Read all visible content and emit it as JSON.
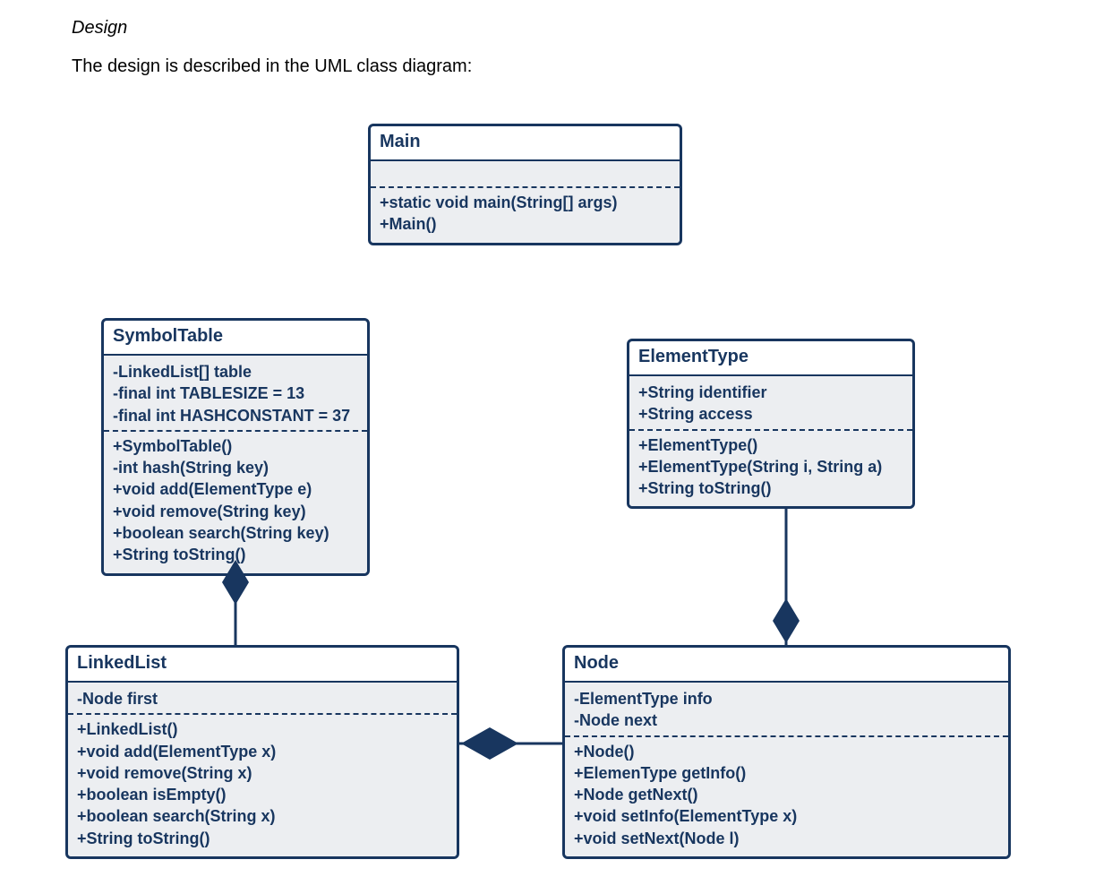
{
  "heading": "Design",
  "intro": "The design is described in the UML class diagram:",
  "classes": {
    "main": {
      "name": "Main",
      "attrs": [],
      "ops": [
        "+static void main(String[] args)",
        "+Main()"
      ]
    },
    "symbolTable": {
      "name": "SymbolTable",
      "attrs": [
        "-LinkedList[] table",
        "-final int TABLESIZE = 13",
        "-final int HASHCONSTANT = 37"
      ],
      "ops": [
        "+SymbolTable()",
        "-int hash(String key)",
        "+void add(ElementType e)",
        "+void remove(String key)",
        "+boolean search(String key)",
        "+String toString()"
      ]
    },
    "elementType": {
      "name": "ElementType",
      "attrs": [
        "+String identifier",
        "+String access"
      ],
      "ops": [
        "+ElementType()",
        "+ElementType(String i, String a)",
        "+String toString()"
      ]
    },
    "linkedList": {
      "name": "LinkedList",
      "attrs": [
        "-Node first"
      ],
      "ops": [
        "+LinkedList()",
        "+void add(ElementType x)",
        "+void remove(String x)",
        "+boolean isEmpty()",
        "+boolean search(String x)",
        "+String toString()"
      ]
    },
    "node": {
      "name": "Node",
      "attrs": [
        "-ElementType info",
        "-Node next"
      ],
      "ops": [
        "+Node()",
        "+ElemenType getInfo()",
        "+Node getNext()",
        "+void setInfo(ElementType x)",
        "+void setNext(Node l)"
      ]
    }
  }
}
